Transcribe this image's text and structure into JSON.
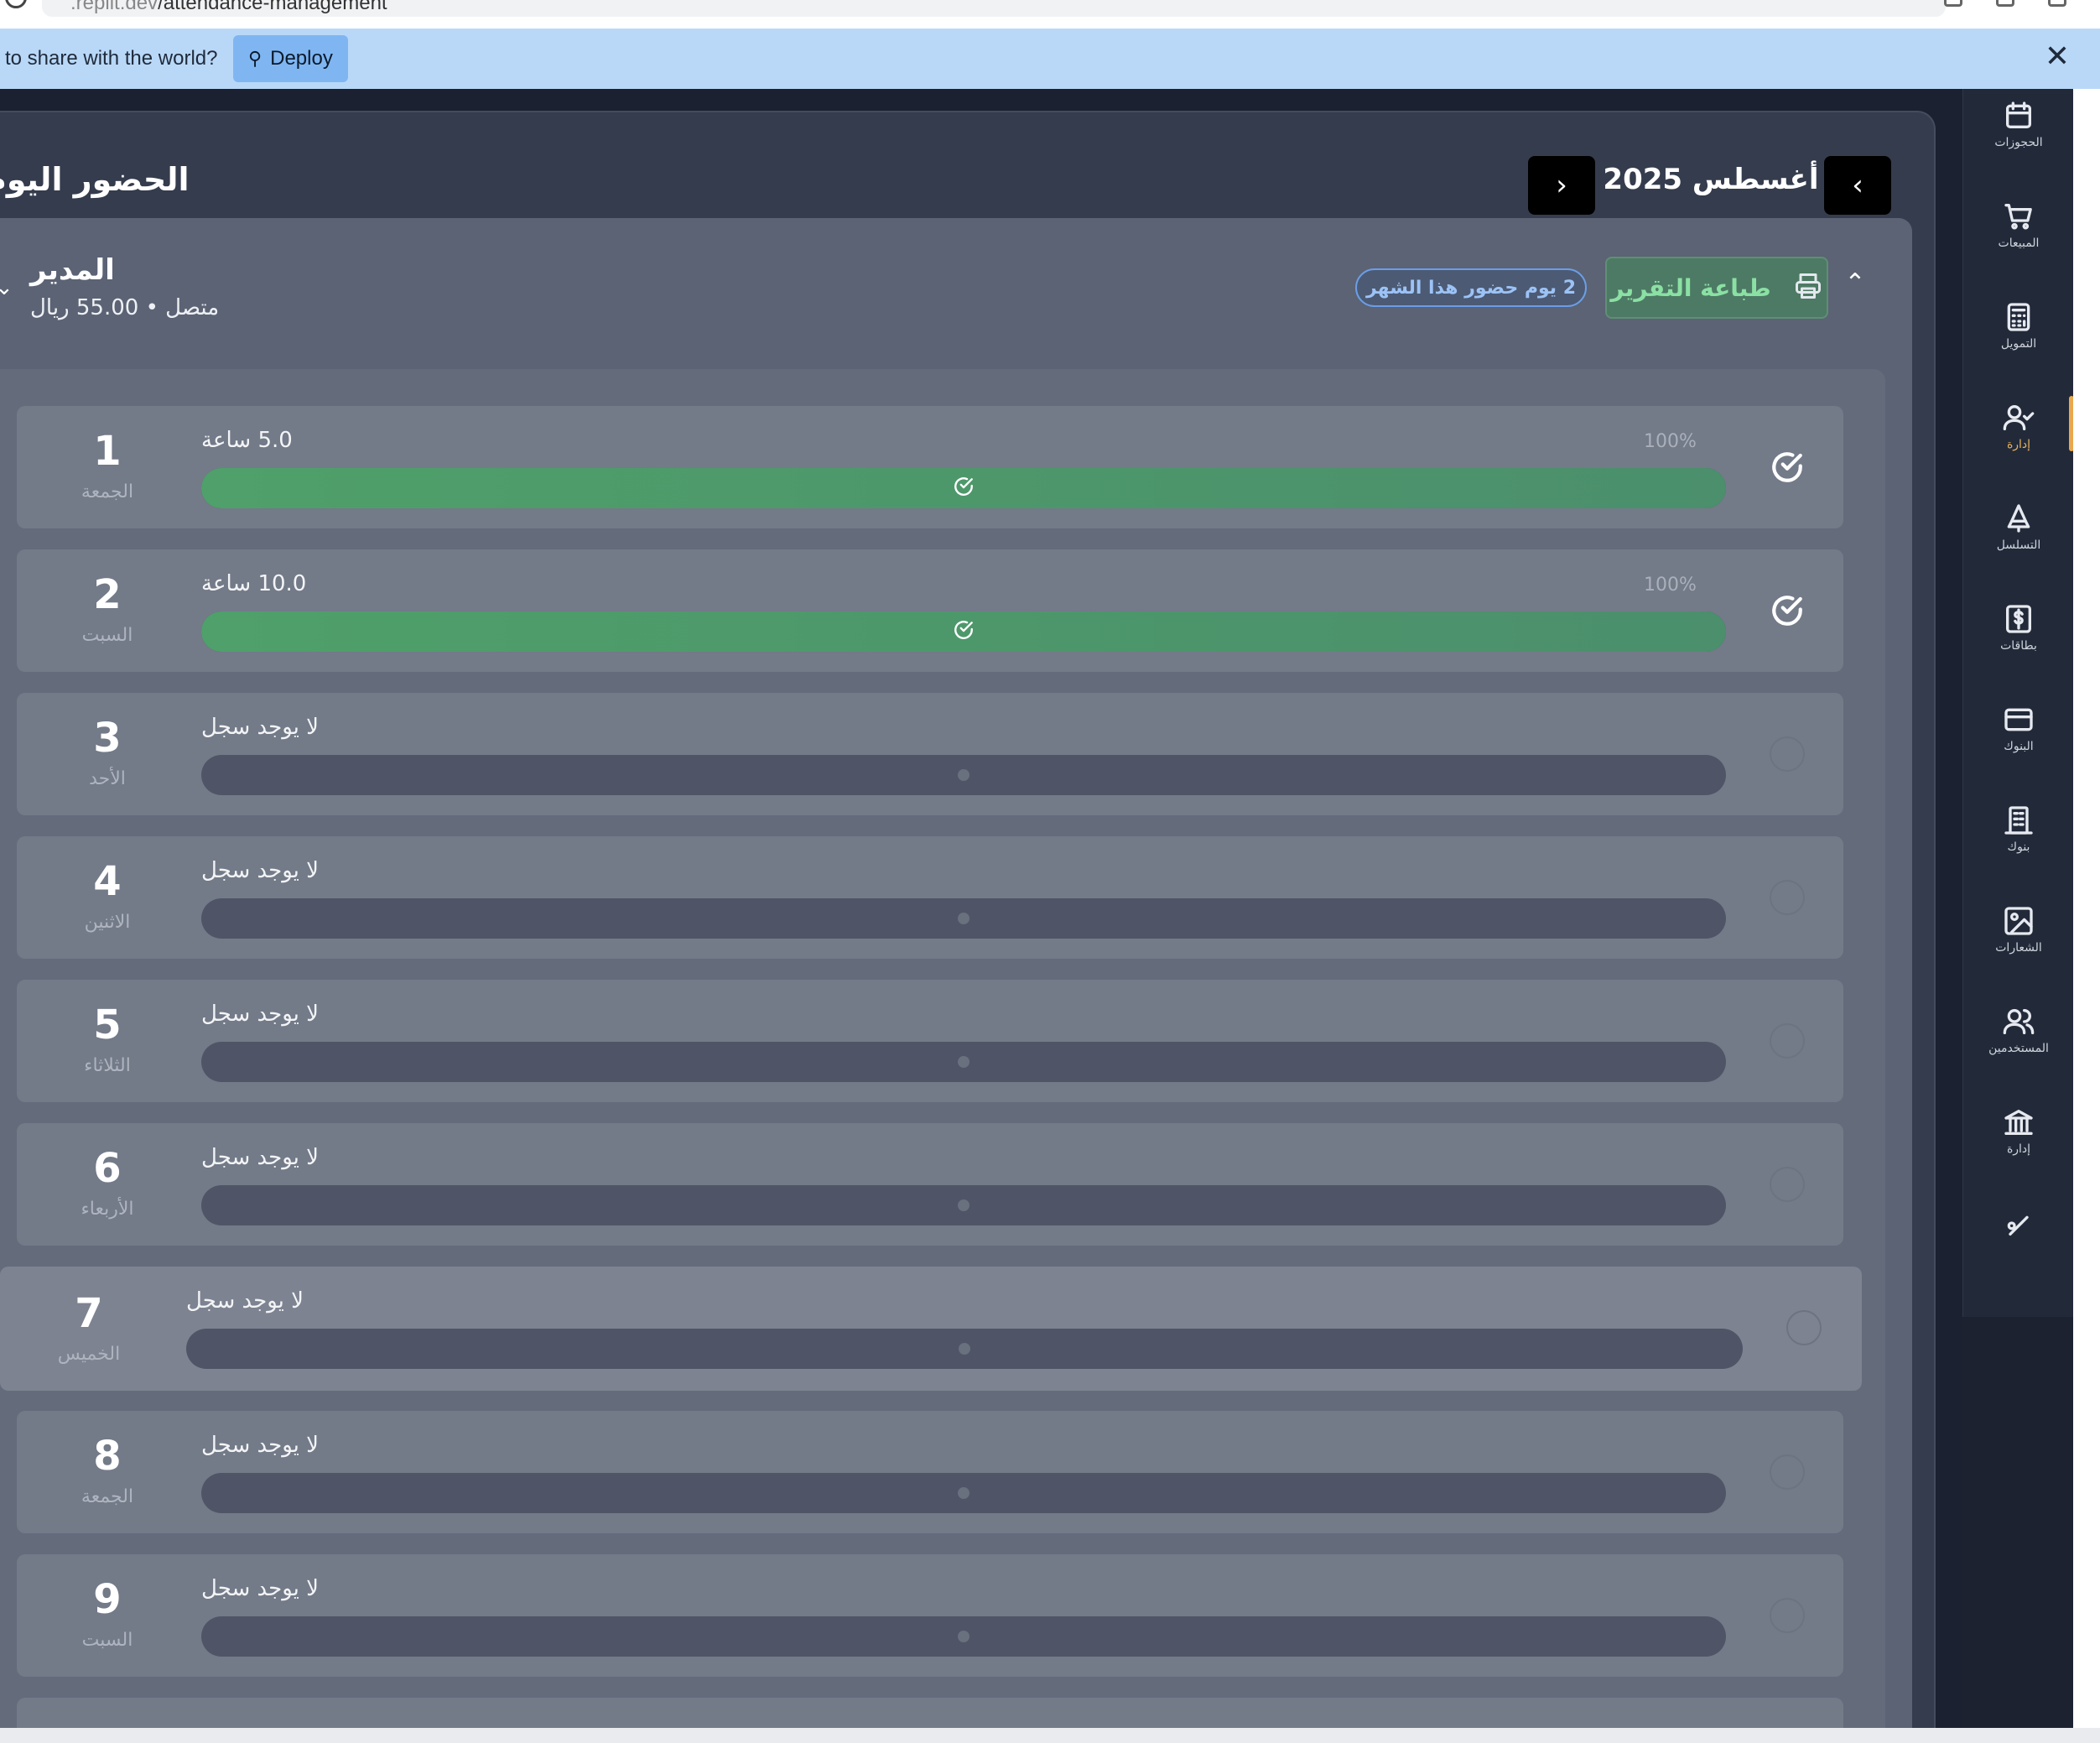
{
  "browser": {
    "url_prefix": ".replit.dev",
    "url_path": "/attendance-management"
  },
  "banner": {
    "text": "to share with the world?",
    "deploy_label": "Deploy",
    "close_glyph": "✕"
  },
  "sidebar": {
    "items": [
      {
        "label": "الحجوزات",
        "icon": "calendar-icon"
      },
      {
        "label": "المبيعات",
        "icon": "cart-icon"
      },
      {
        "label": "التمويل",
        "icon": "calculator-icon"
      },
      {
        "label": "إدارة",
        "icon": "user-check-icon",
        "active": true
      },
      {
        "label": "التسلسل",
        "icon": "tree-icon"
      },
      {
        "label": "بطاقات",
        "icon": "dollar-square-icon"
      },
      {
        "label": "البنوك",
        "icon": "credit-card-icon"
      },
      {
        "label": "بنوك",
        "icon": "building-icon"
      },
      {
        "label": "الشعارات",
        "icon": "image-icon"
      },
      {
        "label": "المستخدمين",
        "icon": "users-icon"
      },
      {
        "label": "إدارة",
        "icon": "bank-icon"
      },
      {
        "label": "",
        "icon": "percent-icon"
      }
    ],
    "accent_color": "#e9a84b"
  },
  "header": {
    "month_label": "أغسطس 2025",
    "prev_glyph": "‹",
    "next_glyph": "›",
    "page_title": "الحضور اليوم"
  },
  "employee": {
    "name": "المدير",
    "subtitle": "متصل • 55.00 ريال",
    "print_label": "طباعة التقرير",
    "attendance_badge": "2 يوم حضور هذا الشهر",
    "collapse_glyph": "⌃",
    "expand_glyph": "⌄"
  },
  "days": [
    {
      "num": "1",
      "name": "الجمعة",
      "hours": "5.0 ساعة",
      "pct": "100%",
      "present": true,
      "fill": 1.0
    },
    {
      "num": "2",
      "name": "السبت",
      "hours": "10.0 ساعة",
      "pct": "100%",
      "present": true,
      "fill": 1.0
    },
    {
      "num": "3",
      "name": "الأحد",
      "hours": "لا يوجد سجل",
      "pct": "",
      "present": false,
      "fill": 0
    },
    {
      "num": "4",
      "name": "الاثنين",
      "hours": "لا يوجد سجل",
      "pct": "",
      "present": false,
      "fill": 0
    },
    {
      "num": "5",
      "name": "الثلاثاء",
      "hours": "لا يوجد سجل",
      "pct": "",
      "present": false,
      "fill": 0
    },
    {
      "num": "6",
      "name": "الأربعاء",
      "hours": "لا يوجد سجل",
      "pct": "",
      "present": false,
      "fill": 0
    },
    {
      "num": "7",
      "name": "الخميس",
      "hours": "لا يوجد سجل",
      "pct": "",
      "present": false,
      "fill": 0,
      "highlight": true
    },
    {
      "num": "8",
      "name": "الجمعة",
      "hours": "لا يوجد سجل",
      "pct": "",
      "present": false,
      "fill": 0
    },
    {
      "num": "9",
      "name": "السبت",
      "hours": "لا يوجد سجل",
      "pct": "",
      "present": false,
      "fill": 0
    }
  ],
  "colors": {
    "present_bar": "#4fa06a",
    "print_text": "#8be0a4",
    "badge_border": "#6b9ee6"
  }
}
